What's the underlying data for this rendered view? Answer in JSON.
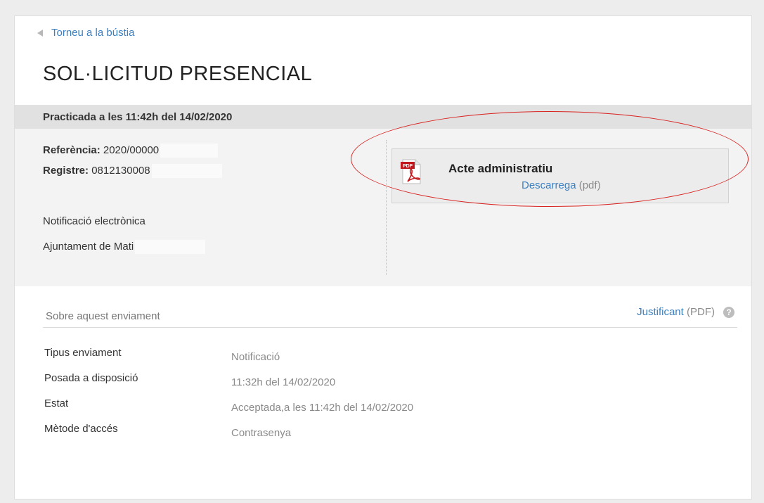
{
  "nav": {
    "back_label": "Torneu a la bústia"
  },
  "page": {
    "title": "SOL·LICITUD PRESENCIAL"
  },
  "summary": {
    "practicada": "Practicada a les 11:42h del 14/02/2020",
    "referencia_label": "Referència:",
    "referencia_value": "2020/00000",
    "registre_label": "Registre:",
    "registre_value": "0812130008",
    "tipus": "Notificació electrònica",
    "organisme": "Ajuntament de Mati"
  },
  "document": {
    "title": "Acte administratiu",
    "download_label": "Descarrega",
    "format_label": "(pdf)",
    "icon": "pdf-file-icon"
  },
  "details": {
    "section_title": "Sobre aquest enviament",
    "justificant_label": "Justificant",
    "justificant_format": "(PDF)",
    "rows": [
      {
        "label": "Tipus enviament",
        "value": "Notificació"
      },
      {
        "label": "Posada a disposició",
        "value": "11:32h del 14/02/2020"
      },
      {
        "label": "Estat",
        "value": "Acceptada,a les 11:42h del 14/02/2020"
      },
      {
        "label": "Mètode d'accés",
        "value": "Contrasenya"
      }
    ]
  },
  "colors": {
    "link": "#3a7fc1",
    "highlight": "#d8221f",
    "pdf_red": "#c0171c"
  }
}
